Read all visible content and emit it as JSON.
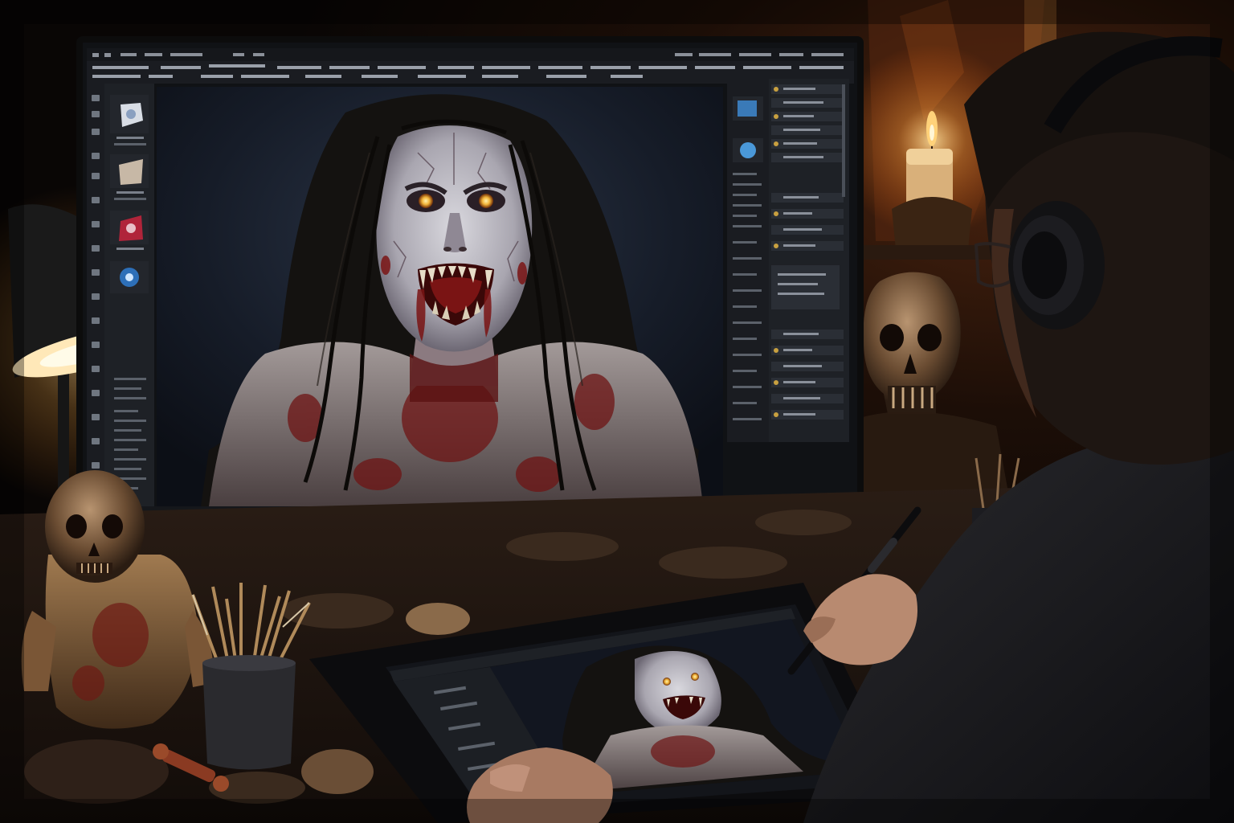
{
  "scene": {
    "colors": {
      "background": "#0b0806",
      "wall_warm": "#3a1a0c",
      "desk": "#1c140f",
      "monitor_bezel": "#111111",
      "app_panel": "#1e2126",
      "app_toolbar": "#15171b",
      "canvas_bg": "#1a2230",
      "lamp_glow": "#ffc980",
      "candle_flame": "#ffd27a",
      "skin_pale": "#c9c9cf",
      "eye_glow": "#f2c04a",
      "blood": "#6e1414",
      "shirt": "#8f8686",
      "hair": "#141210"
    },
    "icons": [
      "desk-lamp-icon",
      "candle-icon",
      "skull-icon",
      "headphones-icon",
      "stylus-icon",
      "pencil-cup-icon"
    ]
  }
}
